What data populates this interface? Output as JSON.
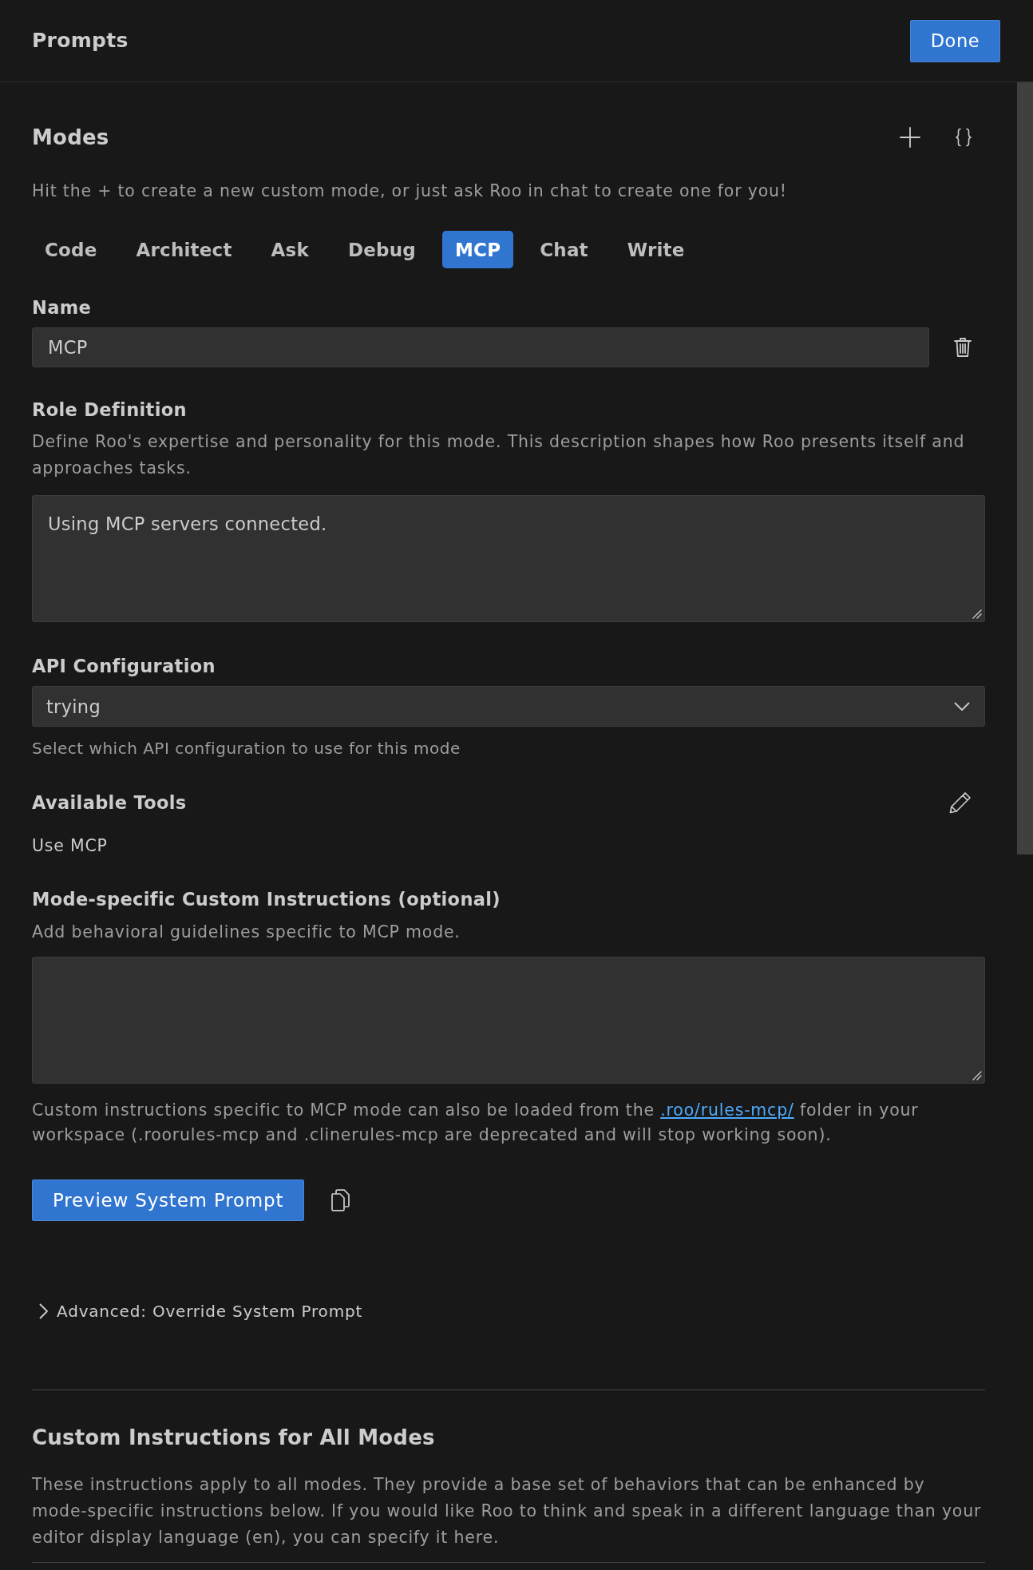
{
  "header": {
    "title": "Prompts",
    "done_button": "Done"
  },
  "modes": {
    "title": "Modes",
    "hint": "Hit the + to create a new custom mode, or just ask Roo in chat to create one for you!",
    "tabs": [
      {
        "label": "Code",
        "selected": false
      },
      {
        "label": "Architect",
        "selected": false
      },
      {
        "label": "Ask",
        "selected": false
      },
      {
        "label": "Debug",
        "selected": false
      },
      {
        "label": "MCP",
        "selected": true
      },
      {
        "label": "Chat",
        "selected": false
      },
      {
        "label": "Write",
        "selected": false
      }
    ]
  },
  "name": {
    "label": "Name",
    "value": "MCP"
  },
  "role_definition": {
    "label": "Role Definition",
    "description": "Define Roo's expertise and personality for this mode. This description shapes how Roo presents itself and approaches tasks.",
    "value": "Using MCP servers connected."
  },
  "api_configuration": {
    "label": "API Configuration",
    "value": "trying",
    "help": "Select which API configuration to use for this mode"
  },
  "available_tools": {
    "label": "Available Tools",
    "tools": [
      "Use MCP"
    ]
  },
  "mode_instructions": {
    "label": "Mode-specific Custom Instructions (optional)",
    "description": "Add behavioral guidelines specific to MCP mode.",
    "note": {
      "before": "Custom instructions specific to MCP mode can also be loaded from the ",
      "link": ".roo/rules-mcp/",
      "after": " folder in your workspace (.roorules-mcp and .clinerules-mcp are deprecated and will stop working soon)."
    }
  },
  "preview_button": "Preview System Prompt",
  "advanced": {
    "label": "Advanced: Override System Prompt",
    "expanded": false
  },
  "global_instructions": {
    "title": "Custom Instructions for All Modes",
    "description": "These instructions apply to all modes. They provide a base set of behaviors that can be enhanced by mode-specific instructions below. If you would like Roo to think and speak in a different language than your editor display language (en), you can specify it here."
  }
}
